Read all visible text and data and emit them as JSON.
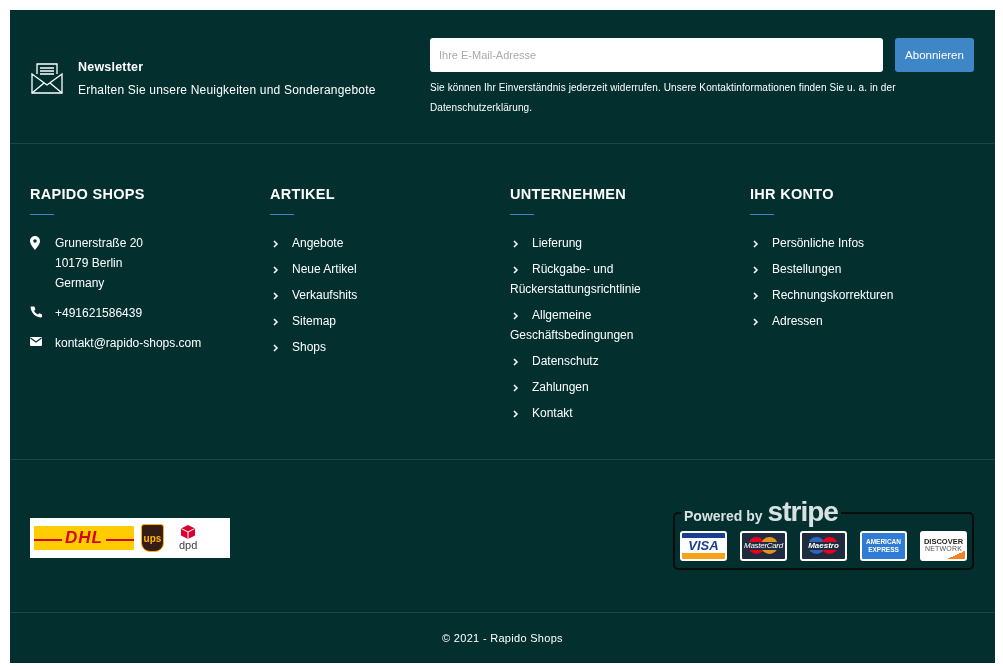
{
  "newsletter": {
    "title": "Newsletter",
    "subtitle": "Erhalten Sie unsere Neuigkeiten und Sonderangebote",
    "placeholder": "Ihre E-Mail-Adresse",
    "button": "Abonnieren",
    "note": "Sie können Ihr Einverständnis jederzeit widerrufen. Unsere Kontaktinformationen finden Sie u. a. in der Datenschutzerklärung."
  },
  "columns": [
    {
      "title": "RAPIDO SHOPS",
      "kind": "contact",
      "items": [
        {
          "kind": "address",
          "lines": [
            "Grunerstraße 20",
            "10179 Berlin",
            "Germany"
          ]
        },
        {
          "kind": "phone",
          "lines": [
            "+491621586439"
          ]
        },
        {
          "kind": "email",
          "lines": [
            "kontakt@rapido-shops.com"
          ]
        }
      ]
    },
    {
      "title": "ARTIKEL",
      "kind": "links",
      "items": [
        {
          "text": "Angebote"
        },
        {
          "text": "Neue Artikel"
        },
        {
          "text": "Verkaufshits"
        },
        {
          "text": "Sitemap"
        },
        {
          "text": "Shops"
        }
      ]
    },
    {
      "title": "UNTERNEHMEN",
      "kind": "links",
      "items": [
        {
          "text": "Lieferung"
        },
        {
          "text": "Rückgabe- und Rückerstattungsrichtlinie"
        },
        {
          "text": "Allgemeine Geschäftsbedingungen"
        },
        {
          "text": "Datenschutz"
        },
        {
          "text": "Zahlungen"
        },
        {
          "text": "Kontakt"
        }
      ]
    },
    {
      "title": "IHR KONTO",
      "kind": "links",
      "items": [
        {
          "text": "Persönliche Infos"
        },
        {
          "text": "Bestellungen"
        },
        {
          "text": "Rechnungskorrekturen"
        },
        {
          "text": "Adressen"
        }
      ]
    }
  ],
  "carriers": [
    {
      "kind": "dhl",
      "label": "DHL"
    },
    {
      "kind": "ups",
      "label": "ups"
    },
    {
      "kind": "dpd",
      "label": "dpd"
    }
  ],
  "payment": {
    "heading": "Powered by",
    "brand": "stripe",
    "cards": [
      {
        "kind": "visa",
        "label": "VISA"
      },
      {
        "kind": "mastercard",
        "label": "MasterCard"
      },
      {
        "kind": "maestro",
        "label": "Maestro"
      },
      {
        "kind": "amex",
        "label": "AMERICAN EXPRESS"
      },
      {
        "kind": "discover",
        "label": "DISCOVER",
        "sub": "NETWORK"
      }
    ]
  },
  "copyright": "© 2021 - Rapido Shops"
}
